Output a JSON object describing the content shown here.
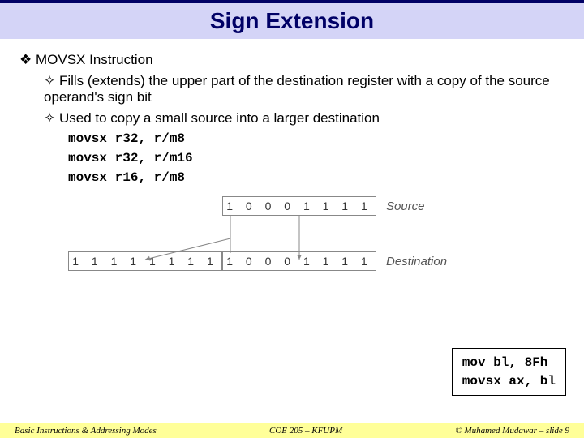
{
  "title": "Sign Extension",
  "lvl1_heading": "MOVSX Instruction",
  "bullets": {
    "b1": "Fills (extends) the upper part of the destination register with a copy of the source operand's sign bit",
    "b2": "Used to copy a small source into a larger destination"
  },
  "syntax": {
    "s1": "movsx r32, r/m8",
    "s2": "movsx r32, r/m16",
    "s3": "movsx r16, r/m8"
  },
  "diagram": {
    "source_bits": "1 0 0 0 1 1 1 1",
    "dest_hi_bits": "1 1 1 1 1 1 1 1",
    "dest_lo_bits": "1 0 0 0 1 1 1 1",
    "source_label": "Source",
    "dest_label": "Destination"
  },
  "code_box": {
    "line1": "mov   bl, 8Fh",
    "line2": "movsx ax, bl"
  },
  "footer": {
    "left": "Basic Instructions & Addressing Modes",
    "center": "COE 205 – KFUPM",
    "right": "© Muhamed Mudawar – slide 9"
  }
}
